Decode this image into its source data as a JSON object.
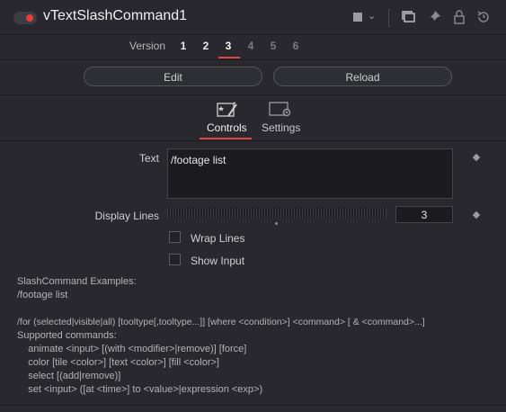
{
  "header": {
    "title": "vTextSlashCommand1",
    "icons": [
      "toggle-switch",
      "color-swatch",
      "chevron-down-icon",
      "copy-icon",
      "pin-icon",
      "lock-icon",
      "reset-icon"
    ],
    "colors": {
      "accent": "#e24444",
      "toggle_dot": "#e63c3c",
      "swatch": "#9a9aa0"
    }
  },
  "version": {
    "label": "Version",
    "items": [
      "1",
      "2",
      "3",
      "4",
      "5",
      "6"
    ],
    "active": "3"
  },
  "buttons": {
    "edit": "Edit",
    "reload": "Reload"
  },
  "tabs": [
    {
      "label": "Controls",
      "icon": "controls-icon",
      "active": true
    },
    {
      "label": "Settings",
      "icon": "settings-icon",
      "active": false
    }
  ],
  "controls": {
    "text_label": "Text",
    "text_value": "/footage list",
    "display_lines_label": "Display Lines",
    "display_lines_value": "3",
    "wrap_lines_label": "Wrap Lines",
    "wrap_lines_checked": false,
    "show_input_label": "Show Input",
    "show_input_checked": false
  },
  "help": [
    "SlashCommand Examples:",
    "/footage list",
    "",
    "/for (selected|visible|all) [tooltype[,tooltype...]] [where <condition>] <command> [ & <command>...]",
    "Supported commands:",
    "    animate <input> [(with <modifier>|remove)] [force]",
    "    color [tile <color>] [text <color>] [fill <color>]",
    "    select [(add|remove)]",
    "    set <input> ([at <time>] to <value>|expression <exp>)"
  ]
}
